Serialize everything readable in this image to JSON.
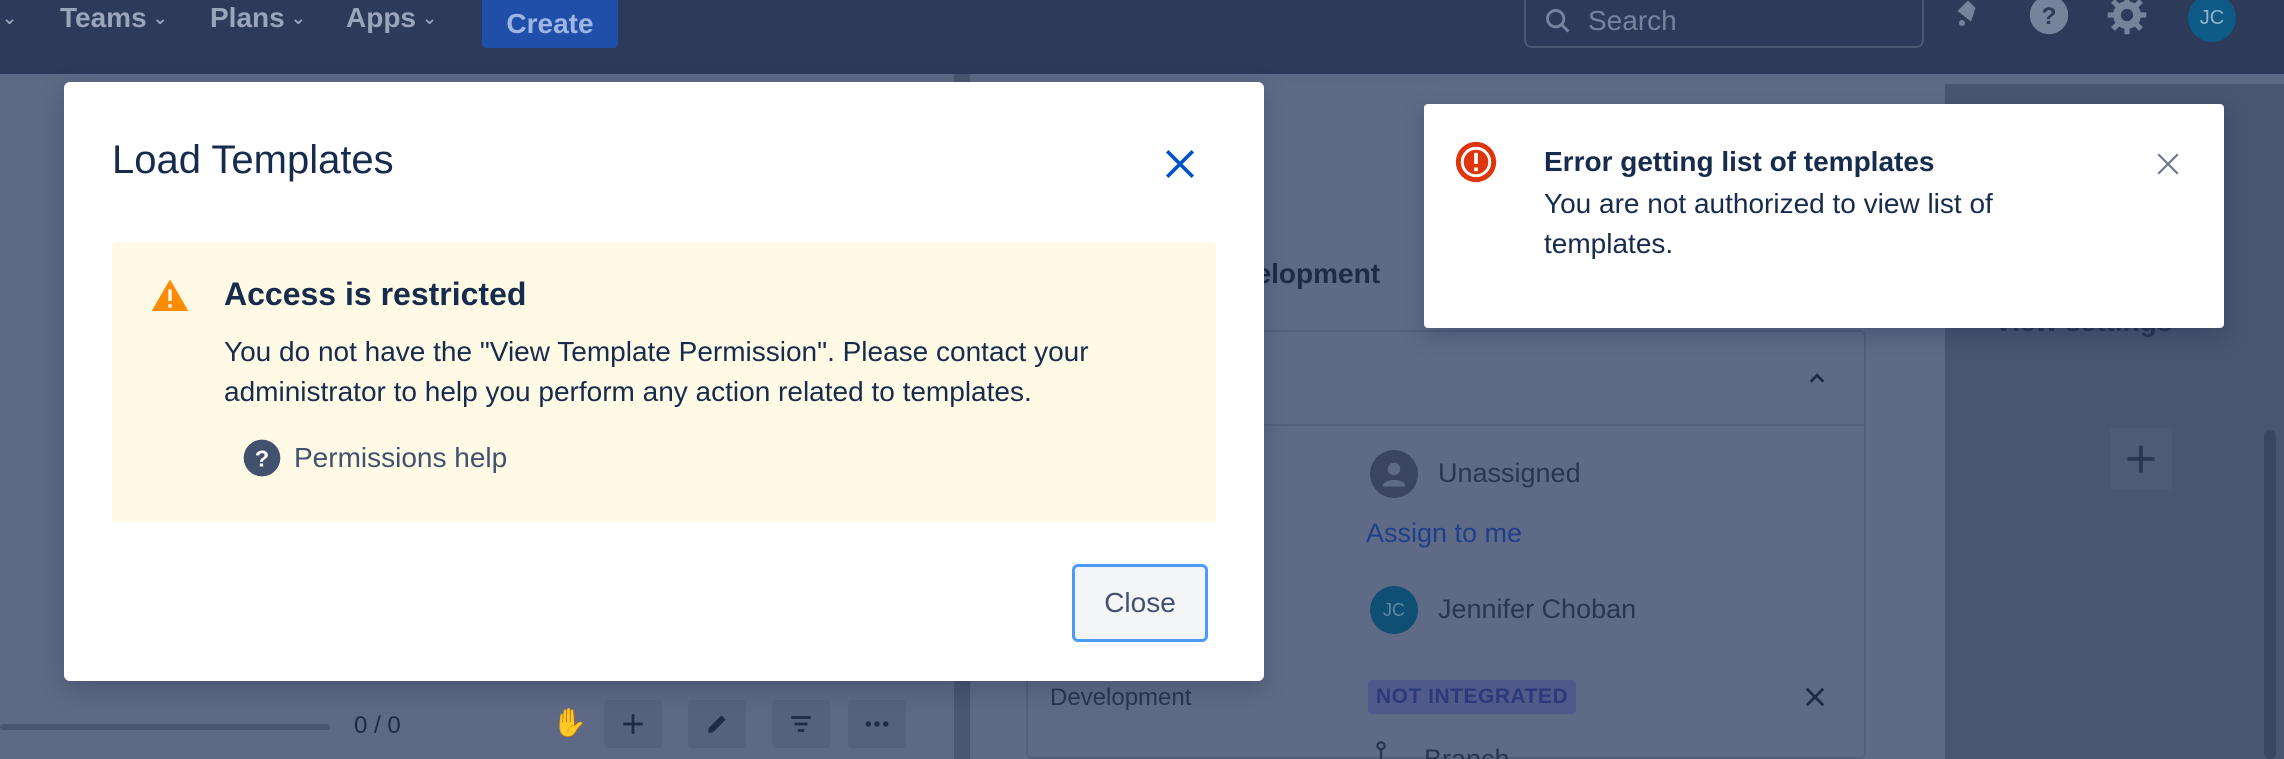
{
  "topnav": {
    "teams_label": "Teams",
    "plans_label": "Plans",
    "apps_label": "Apps",
    "create_label": "Create",
    "search_placeholder": "Search",
    "avatar_initials": "JC"
  },
  "background": {
    "section_label": "velopment",
    "settings_label": "View settings",
    "assignee_value": "Unassigned",
    "assign_to_me_link": "Assign to me",
    "reporter_name": "Jennifer Choban",
    "reporter_initials": "JC",
    "development_label": "Development",
    "development_status": "NOT INTEGRATED",
    "branch_label": "Branch",
    "progress_counter": "0 / 0"
  },
  "modal": {
    "title": "Load Templates",
    "warning": {
      "title": "Access is restricted",
      "body": "You do not have the \"View Template Permission\". Please contact your administrator to help you perform any action related to templates.",
      "help_link": "Permissions help"
    },
    "close_button": "Close"
  },
  "flag": {
    "title": "Error getting list of templates",
    "body": "You are not authorized to view list of templates."
  },
  "colors": {
    "warning_icon": "#ff8b00",
    "warning_bg": "#fefae6",
    "error_icon": "#de350b",
    "close_icon": "#0052cc",
    "focus_ring": "#4c9aff",
    "link": "#0052cc"
  }
}
